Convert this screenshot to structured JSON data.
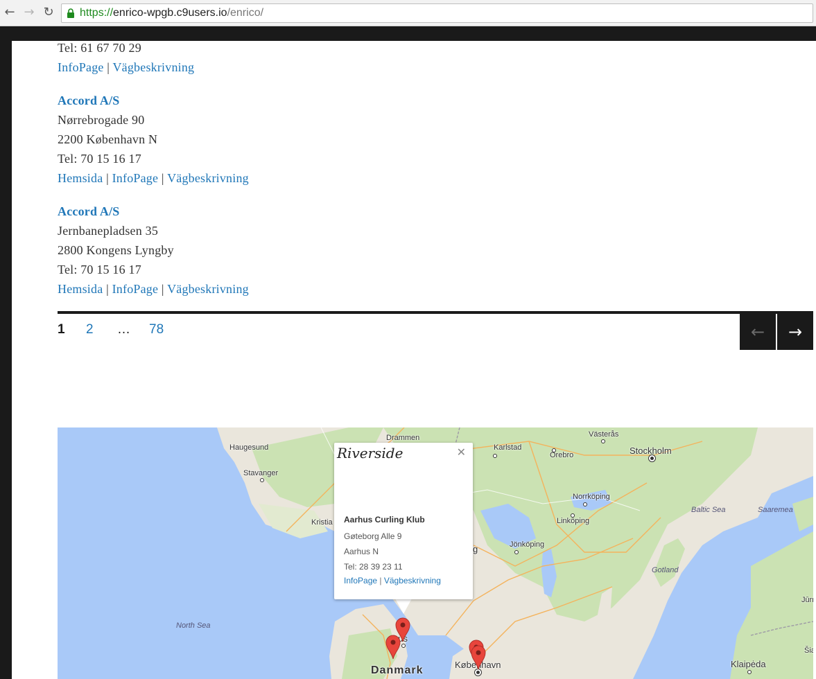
{
  "browser": {
    "url_scheme": "https://",
    "url_host": "enrico-wpgb.c9users.io",
    "url_path": "/enrico/"
  },
  "listing": {
    "partial_top": {
      "tel": "Tel: 61 67 70 29",
      "links": [
        "InfoPage",
        "Vägbeskrivning"
      ]
    },
    "entries": [
      {
        "name": "Accord A/S",
        "street": "Nørrebrogade 90",
        "city": "2200 København N",
        "tel": "Tel: 70 15 16 17",
        "links": [
          "Hemsida",
          "InfoPage",
          "Vägbeskrivning"
        ]
      },
      {
        "name": "Accord A/S",
        "street": "Jernbanepladsen 35",
        "city": "2800 Kongens Lyngby",
        "tel": "Tel: 70 15 16 17",
        "links": [
          "Hemsida",
          "InfoPage",
          "Vägbeskrivning"
        ]
      }
    ],
    "link_separator": "|"
  },
  "pagination": {
    "current": "1",
    "pages": [
      "2",
      "78"
    ],
    "ellipsis": "…",
    "prev_icon": "arrow-left-icon",
    "next_icon": "arrow-right-icon"
  },
  "map": {
    "places": {
      "drammen": "Drammen",
      "haugesund": "Haugesund",
      "stavanger": "Stavanger",
      "kristiansand": "Kristia",
      "karlstad": "Karlstad",
      "orebro": "Örebro",
      "vasteras": "Västerås",
      "stockholm": "Stockholm",
      "norrkoping": "Norrköping",
      "linkoping": "Linköping",
      "jonkoping": "Jönköping",
      "goteborg_fragment": "g",
      "baltic_sea": "Baltic Sea",
      "saaremaa": "Saaremea",
      "gotland": "Gotland",
      "north_sea": "North Sea",
      "aarhus_fragment": "hus",
      "denmark": "Danmark",
      "kobenhavn": "København",
      "jurmala_fragment": "Jūrm",
      "siauliai_fragment": "Šia",
      "klaipeda": "Klaipėda"
    },
    "info_window": {
      "logo_text": "Riverside",
      "name": "Aarhus Curling Klub",
      "street": "Gøteborg Alle 9",
      "city": "Aarhus N",
      "tel": "Tel: 28 39 23 11",
      "links": [
        "InfoPage",
        "Vägbeskrivning"
      ],
      "link_separator": "|",
      "close_icon": "close-icon"
    },
    "colors": {
      "water": "#a9c9f8",
      "land": "#eae6dc",
      "forest": "#cbe2b3",
      "marker": "#e8453c"
    }
  }
}
